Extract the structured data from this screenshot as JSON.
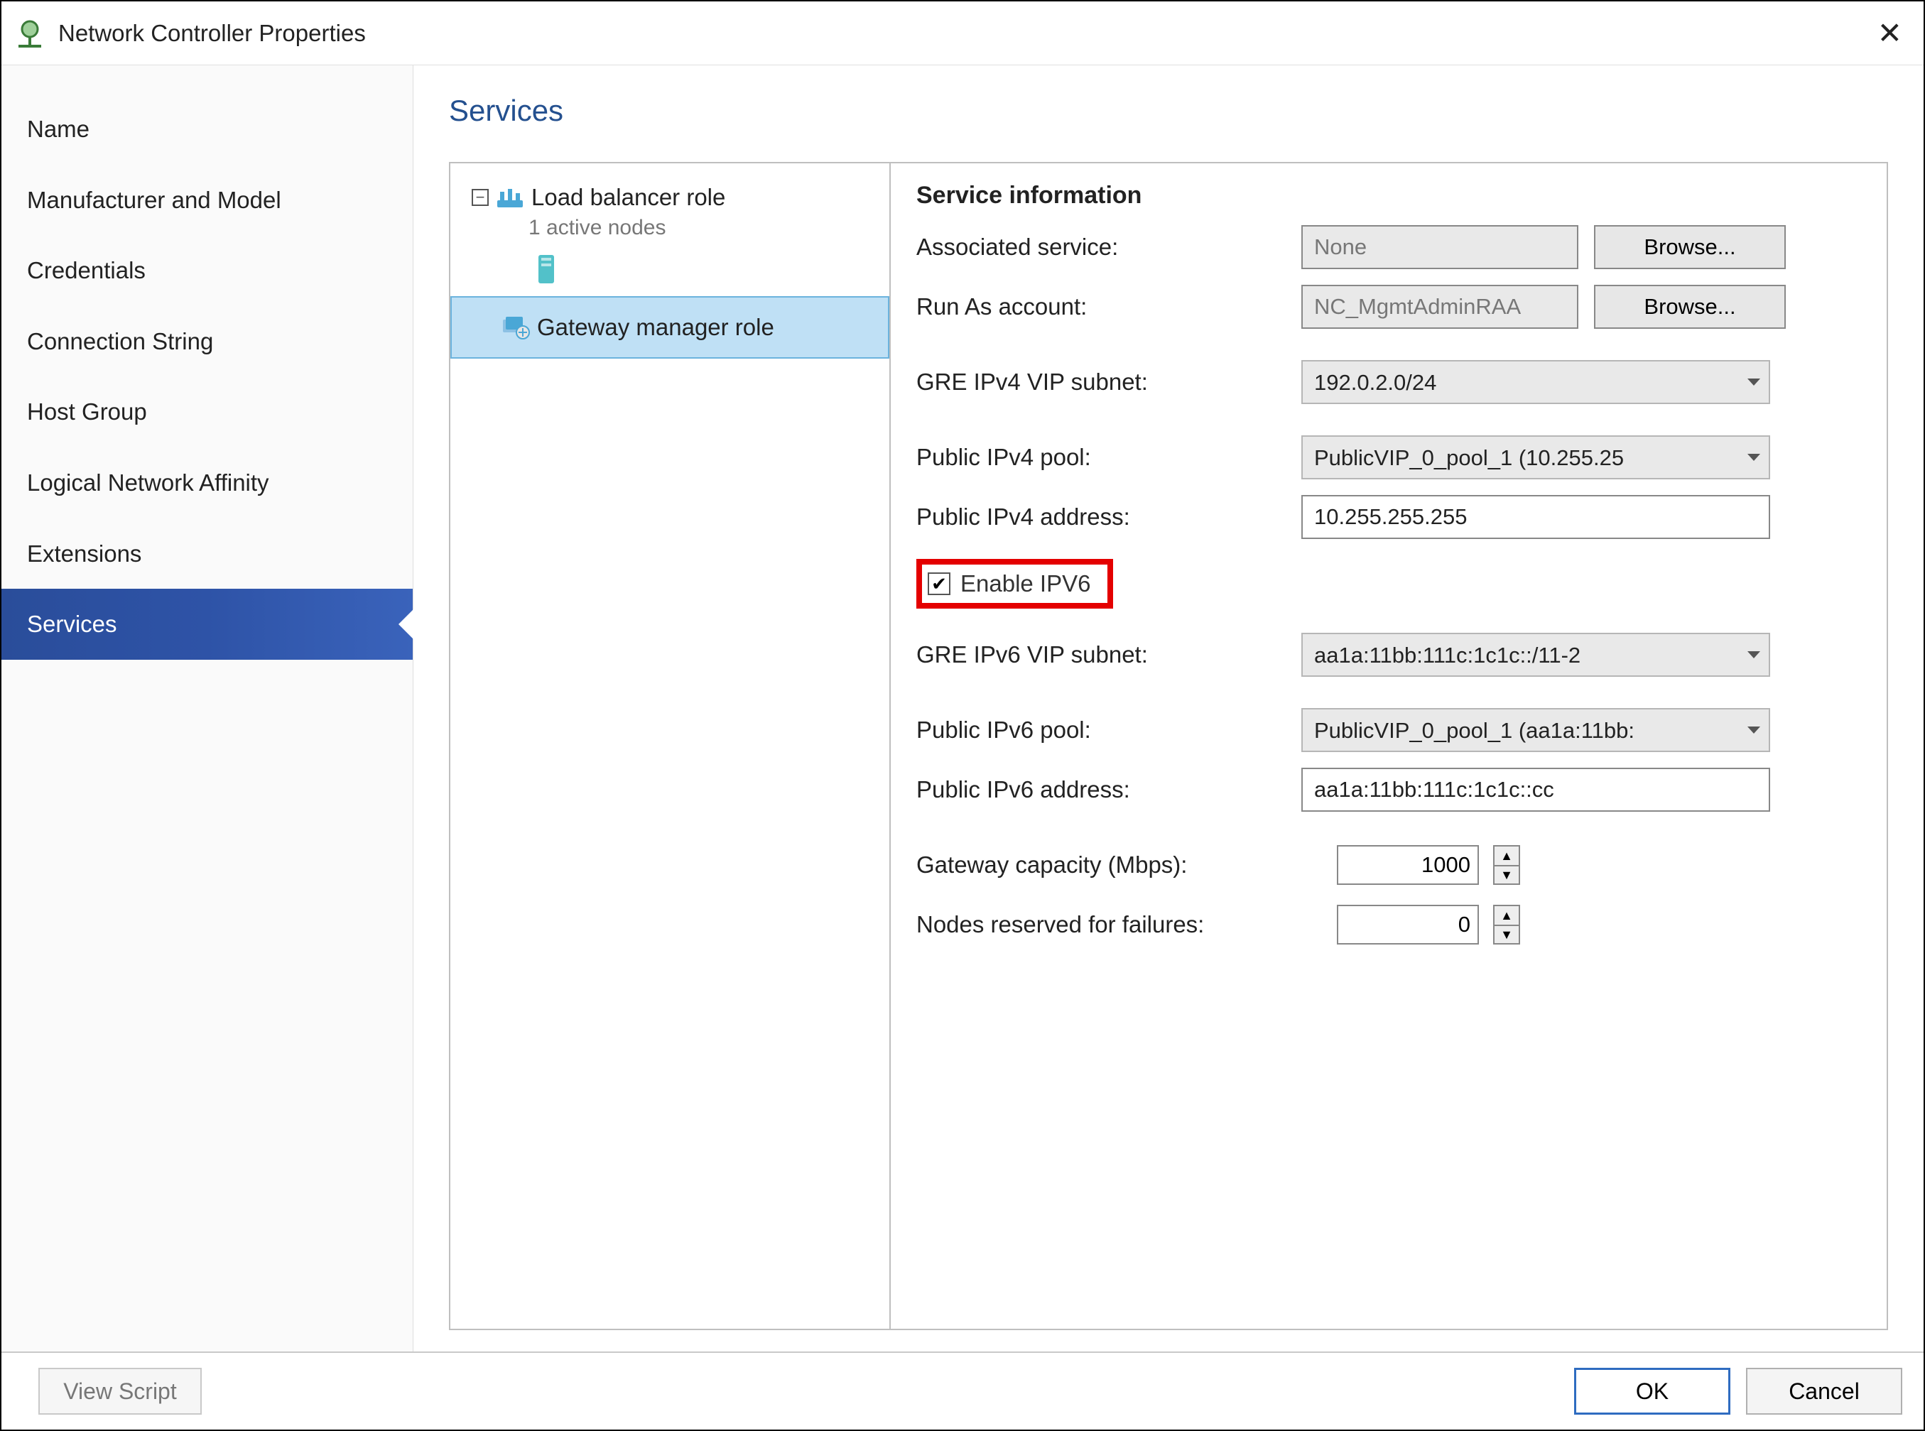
{
  "window": {
    "title": "Network Controller Properties"
  },
  "sidebar": {
    "items": [
      {
        "label": "Name"
      },
      {
        "label": "Manufacturer and Model"
      },
      {
        "label": "Credentials"
      },
      {
        "label": "Connection String"
      },
      {
        "label": "Host Group"
      },
      {
        "label": "Logical Network Affinity"
      },
      {
        "label": "Extensions"
      },
      {
        "label": "Services",
        "selected": true
      }
    ]
  },
  "main": {
    "title": "Services",
    "tree": {
      "load_balancer": {
        "label": "Load balancer role",
        "subtitle": "1 active nodes"
      },
      "gateway_manager": {
        "label": "Gateway manager role"
      }
    },
    "form": {
      "heading": "Service information",
      "associated_service": {
        "label": "Associated service:",
        "value": "None",
        "browse": "Browse..."
      },
      "run_as": {
        "label": "Run As account:",
        "value": "NC_MgmtAdminRAA",
        "browse": "Browse..."
      },
      "gre_ipv4": {
        "label": "GRE IPv4 VIP subnet:",
        "value": "192.0.2.0/24"
      },
      "public_ipv4_pool": {
        "label": "Public IPv4 pool:",
        "value": "PublicVIP_0_pool_1 (10.255.25"
      },
      "public_ipv4_addr": {
        "label": "Public IPv4 address:",
        "value": "10.255.255.255"
      },
      "enable_ipv6": {
        "label": "Enable IPV6",
        "checked": true
      },
      "gre_ipv6": {
        "label": "GRE IPv6 VIP subnet:",
        "value": "aa1a:11bb:111c:1c1c::/11-2"
      },
      "public_ipv6_pool": {
        "label": "Public IPv6 pool:",
        "value": "PublicVIP_0_pool_1 (aa1a:11bb:"
      },
      "public_ipv6_addr": {
        "label": "Public IPv6 address:",
        "value": "aa1a:11bb:111c:1c1c::cc"
      },
      "gateway_capacity": {
        "label": "Gateway capacity (Mbps):",
        "value": "1000"
      },
      "nodes_reserved": {
        "label": "Nodes reserved for failures:",
        "value": "0"
      }
    }
  },
  "footer": {
    "view_script": "View Script",
    "ok": "OK",
    "cancel": "Cancel"
  }
}
